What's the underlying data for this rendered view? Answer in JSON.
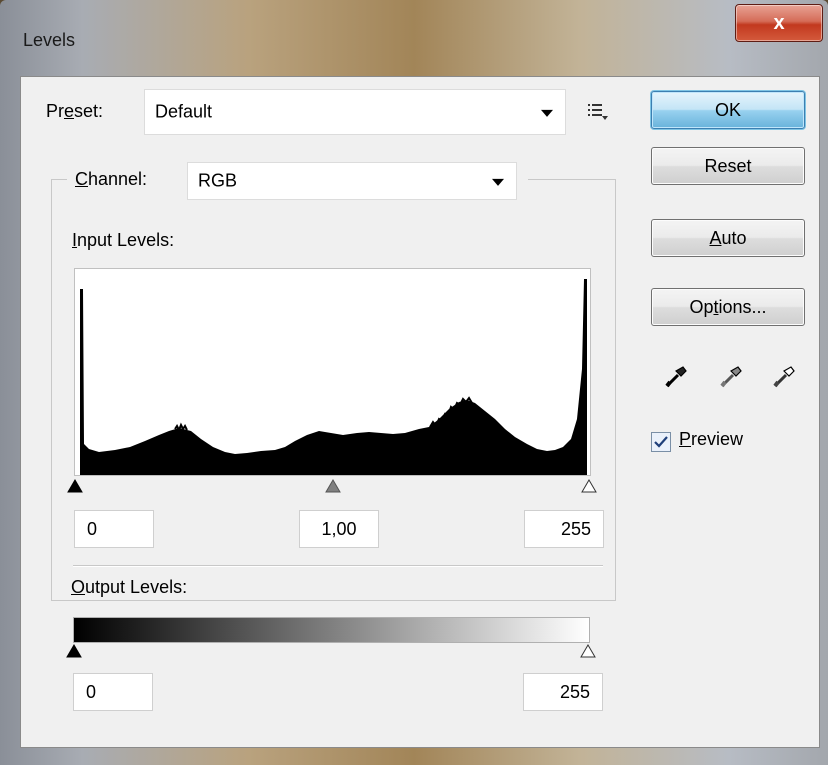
{
  "window": {
    "title": "Levels",
    "close_glyph": "x"
  },
  "preset": {
    "label": "Preset:",
    "value": "Default",
    "menu_icon": "list-menu-icon"
  },
  "buttons": {
    "ok": "OK",
    "reset": "Reset",
    "auto": "Auto",
    "options": "Options..."
  },
  "channel": {
    "label": "Channel:",
    "value": "RGB"
  },
  "input_levels": {
    "label": "Input Levels:",
    "black": "0",
    "gamma": "1,00",
    "white": "255"
  },
  "output_levels": {
    "label": "Output Levels:",
    "black": "0",
    "white": "255"
  },
  "eyedroppers": [
    "black-point-eyedropper-icon",
    "gray-point-eyedropper-icon",
    "white-point-eyedropper-icon"
  ],
  "preview": {
    "label": "Preview",
    "checked": true
  }
}
